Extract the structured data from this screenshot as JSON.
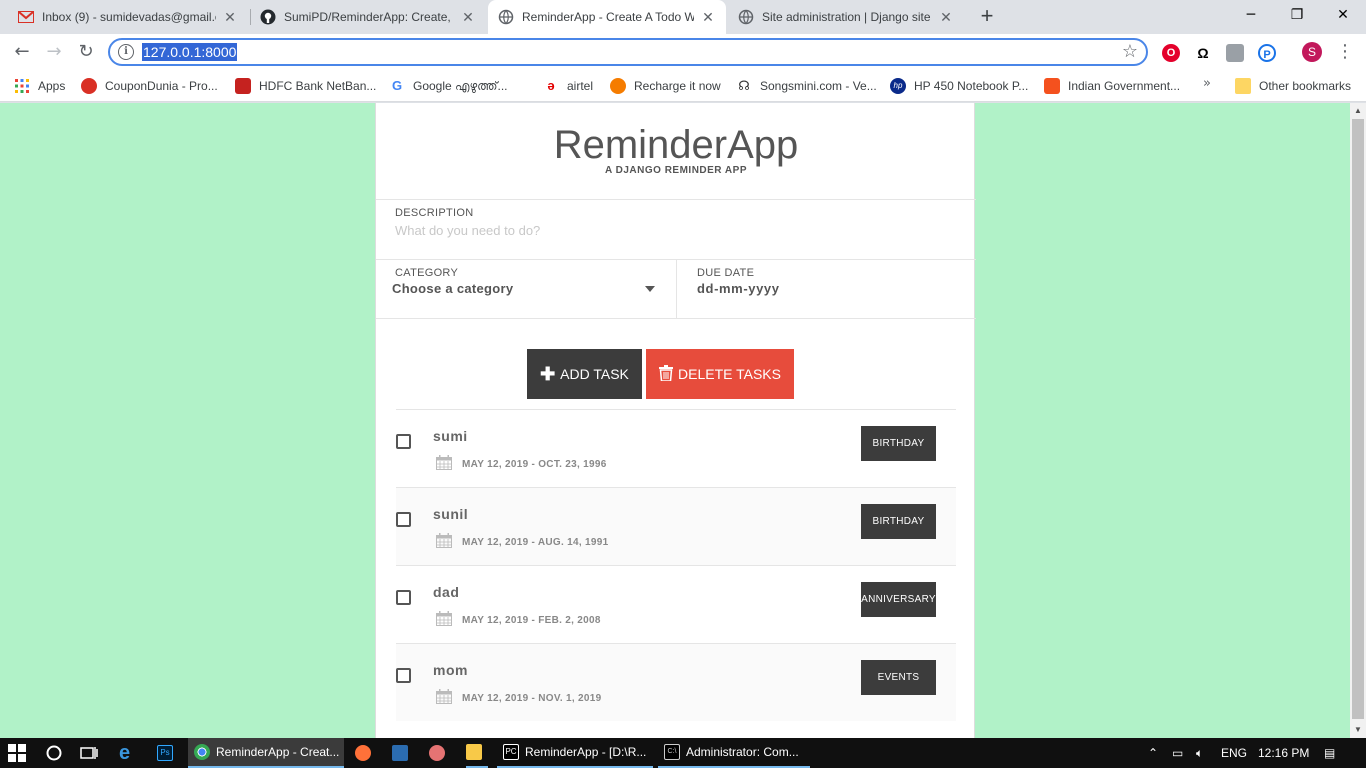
{
  "browser": {
    "tabs": [
      {
        "title": "Inbox (9) - sumidevadas@gmail.c",
        "icon": "gmail-icon",
        "active": false
      },
      {
        "title": "SumiPD/ReminderApp: Create, Up",
        "icon": "github-icon",
        "active": false
      },
      {
        "title": "ReminderApp - Create A Todo W",
        "icon": "globe-icon",
        "active": true
      },
      {
        "title": "Site administration | Django site a",
        "icon": "globe-icon",
        "active": false
      }
    ],
    "new_tab_label": "+",
    "address": "127.0.0.1:8000",
    "profile_initial": "S",
    "bookmarks": [
      {
        "label": "Apps",
        "color": "#e8453c"
      },
      {
        "label": "CouponDunia - Pro...",
        "color": "#d93025"
      },
      {
        "label": "HDFC Bank NetBan...",
        "color": "#c5221f"
      },
      {
        "label": "Google എഴുത്ത്...",
        "color": "#4285f4"
      },
      {
        "label": "airtel",
        "color": "#e40000"
      },
      {
        "label": "Recharge it now",
        "color": "#f57c00"
      },
      {
        "label": "Songsmini.com - Ve...",
        "color": "#333333"
      },
      {
        "label": "HP 450 Notebook P...",
        "color": "#0a2a8a"
      },
      {
        "label": "Indian Government...",
        "color": "#f4511e"
      }
    ],
    "bookmarks_more": "»",
    "other_bookmarks": "Other bookmarks"
  },
  "app": {
    "title": "ReminderApp",
    "subtitle": "A DJANGO REMINDER APP",
    "description_label": "DESCRIPTION",
    "description_placeholder": "What do you need to do?",
    "category_label": "CATEGORY",
    "category_value": "Choose a category",
    "due_date_label": "DUE DATE",
    "due_date_value": "dd-mm-yyyy",
    "add_button": "ADD TASK",
    "delete_button": "DELETE TASKS",
    "tasks": [
      {
        "name": "sumi",
        "dates": "MAY 12, 2019 - OCT. 23, 1996",
        "category": "BIRTHDAY"
      },
      {
        "name": "sunil",
        "dates": "MAY 12, 2019 - AUG. 14, 1991",
        "category": "BIRTHDAY"
      },
      {
        "name": "dad",
        "dates": "MAY 12, 2019 - FEB. 2, 2008",
        "category": "ANNIVERSARY"
      },
      {
        "name": "mom",
        "dates": "MAY 12, 2019 - NOV. 1, 2019",
        "category": "EVENTS"
      }
    ]
  },
  "taskbar": {
    "items": [
      {
        "label": "ReminderApp - Creat...",
        "icon": "chrome-icon"
      },
      {
        "label": "ReminderApp - [D:\\R...",
        "icon": "pycharm-icon"
      },
      {
        "label": "Administrator: Com...",
        "icon": "cmd-icon"
      }
    ],
    "language": "ENG",
    "clock": "12:16 PM"
  },
  "colors": {
    "page_bg": "#b1f2c8",
    "dark_button": "#3c3c3c",
    "delete_button": "#e74c3c",
    "url_highlight": "#3367d6"
  }
}
